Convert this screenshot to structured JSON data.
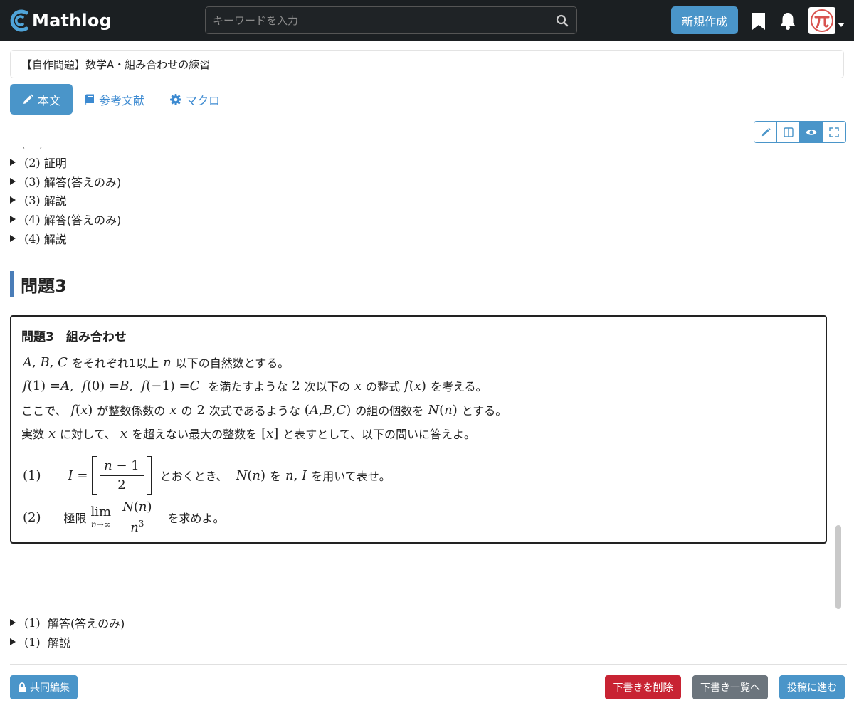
{
  "navbar": {
    "brand": "Mathlog",
    "search_placeholder": "キーワードを入力",
    "new_button": "新規作成"
  },
  "document": {
    "title": "【自作問題】数学A・組み合わせの練習"
  },
  "tabs": [
    {
      "label": "本文",
      "active": true
    },
    {
      "label": "参考文献",
      "active": false
    },
    {
      "label": "マクロ",
      "active": false
    }
  ],
  "collapsed_top": [
    {
      "num": "(2)",
      "label": "証明"
    },
    {
      "num": "(3)",
      "label": "解答(答えのみ)"
    },
    {
      "num": "(3)",
      "label": "解説"
    },
    {
      "num": "(4)",
      "label": "解答(答えのみ)"
    },
    {
      "num": "(4)",
      "label": "解説"
    }
  ],
  "section_heading": "問題3",
  "problem": {
    "title": "問題3　組み合わせ",
    "line1_text": "をそれぞれ1以上",
    "line1_text2": "以下の自然数とする。",
    "line2_text": "を満たすような",
    "line2_text2": "次以下の",
    "line2_text3": "の整式",
    "line2_text4": "を考える。",
    "line3_text": "ここで、",
    "line3_text2": "が整数係数の",
    "line3_text3": "の",
    "line3_text4": "次式であるような",
    "line3_text5": "の組の個数を",
    "line3_text6": "とする。",
    "line4_text": "実数",
    "line4_text2": "に対して、",
    "line4_text3": "を超えない最大の整数を",
    "line4_text4": "と表すとして、以下の問いに答えよ。",
    "q1_num": "(1)",
    "q1_text": "とおくとき、",
    "q1_text2": "を",
    "q1_text3": "を用いて表せ。",
    "q2_num": "(2)",
    "q2_label": "極限",
    "q2_text": "を求めよ。"
  },
  "collapsed_bottom": [
    {
      "num": "(1)",
      "label": "解答(答えのみ)"
    },
    {
      "num": "(1)",
      "label": "解説"
    }
  ],
  "footer": {
    "collab_button": "共同編集",
    "delete_button": "下書きを削除",
    "list_button": "下書き一覧へ",
    "post_button": "投稿に進む"
  },
  "colors": {
    "navbar_bg": "#1b1f22",
    "primary": "#4a95c9",
    "link": "#3c8ad1",
    "danger": "#c82333",
    "secondary": "#6c757d",
    "heading_bar": "#4a7db8"
  }
}
